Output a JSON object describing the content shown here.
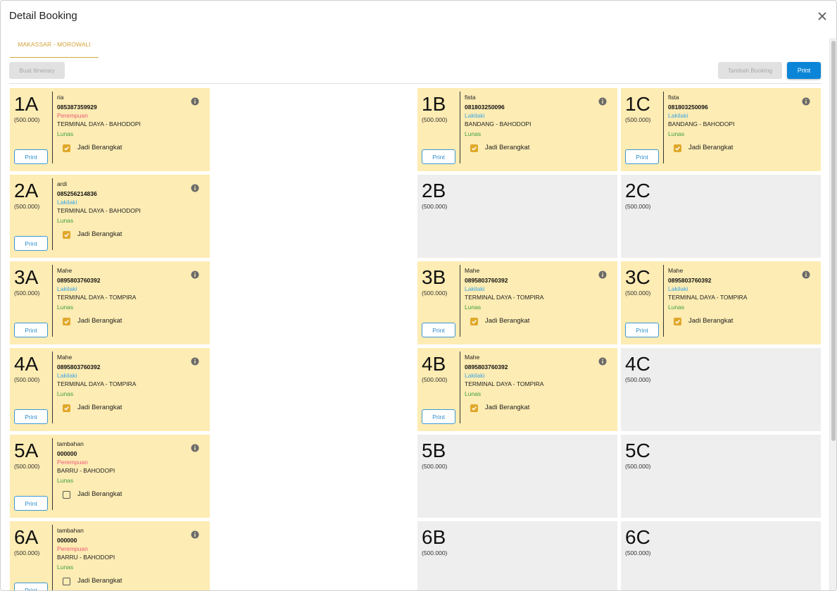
{
  "dialog": {
    "title": "Detail Booking",
    "tab_label": "MAKASSAR - MOROWALI",
    "itinerary_label": "Buat Itinerary",
    "tambah_label": "Tambah Booking",
    "print_label": "Print",
    "checkbox_label": "Jadi Berangkat",
    "seat_print_label": "Print"
  },
  "colors": {
    "accent": "#d4a33a",
    "booked_bg": "#fdecb3",
    "empty_bg": "#eeeeee",
    "primary": "#0b85d8",
    "male": "#39a7e6",
    "female": "#ee5a7a",
    "paid": "#3fa13f"
  },
  "seats": [
    {
      "code": "1A",
      "price": "(500.000)",
      "booked": true,
      "name": "ria",
      "phone": "085387359929",
      "gender": "Perempuan",
      "route": "TERMINAL DAYA - BAHODOPI",
      "status": "Lunas",
      "departed": true
    },
    {
      "code": "1B",
      "price": "(500.000)",
      "booked": true,
      "name": "fista",
      "phone": "081803250096",
      "gender": "Lakilaki",
      "route": "BANDANG - BAHODOPI",
      "status": "Lunas",
      "departed": true
    },
    {
      "code": "1C",
      "price": "(500.000)",
      "booked": true,
      "name": "fista",
      "phone": "081803250096",
      "gender": "Lakilaki",
      "route": "BANDANG - BAHODOPI",
      "status": "Lunas",
      "departed": true
    },
    {
      "code": "2A",
      "price": "(500.000)",
      "booked": true,
      "name": "ardi",
      "phone": "085256214836",
      "gender": "Lakilaki",
      "route": "TERMINAL DAYA - BAHODOPI",
      "status": "Lunas",
      "departed": true
    },
    {
      "code": "2B",
      "price": "(500.000)",
      "booked": false
    },
    {
      "code": "2C",
      "price": "(500.000)",
      "booked": false
    },
    {
      "code": "3A",
      "price": "(500.000)",
      "booked": true,
      "name": "Mahe",
      "phone": "0895803760392",
      "gender": "Lakilaki",
      "route": "TERMINAL DAYA - TOMPIRA",
      "status": "Lunas",
      "departed": true
    },
    {
      "code": "3B",
      "price": "(500.000)",
      "booked": true,
      "name": "Mahe",
      "phone": "0895803760392",
      "gender": "Lakilaki",
      "route": "TERMINAL DAYA - TOMPIRA",
      "status": "Lunas",
      "departed": true
    },
    {
      "code": "3C",
      "price": "(500.000)",
      "booked": true,
      "name": "Mahe",
      "phone": "0895803760392",
      "gender": "Lakilaki",
      "route": "TERMINAL DAYA - TOMPIRA",
      "status": "Lunas",
      "departed": true
    },
    {
      "code": "4A",
      "price": "(500.000)",
      "booked": true,
      "name": "Mahe",
      "phone": "0895803760392",
      "gender": "Lakilaki",
      "route": "TERMINAL DAYA - TOMPIRA",
      "status": "Lunas",
      "departed": true
    },
    {
      "code": "4B",
      "price": "(500.000)",
      "booked": true,
      "name": "Mahe",
      "phone": "0895803760392",
      "gender": "Lakilaki",
      "route": "TERMINAL DAYA - TOMPIRA",
      "status": "Lunas",
      "departed": true
    },
    {
      "code": "4C",
      "price": "(500.000)",
      "booked": false
    },
    {
      "code": "5A",
      "price": "(500.000)",
      "booked": true,
      "name": "tambahan",
      "phone": "000000",
      "gender": "Perempuan",
      "route": "BARRU - BAHODOPI",
      "status": "Lunas",
      "departed": false
    },
    {
      "code": "5B",
      "price": "(500.000)",
      "booked": false
    },
    {
      "code": "5C",
      "price": "(500.000)",
      "booked": false
    },
    {
      "code": "6A",
      "price": "(500.000)",
      "booked": true,
      "name": "tambahan",
      "phone": "000000",
      "gender": "Perempuan",
      "route": "BARRU - BAHODOPI",
      "status": "Lunas",
      "departed": false
    },
    {
      "code": "6B",
      "price": "(500.000)",
      "booked": false
    },
    {
      "code": "6C",
      "price": "(500.000)",
      "booked": false
    }
  ]
}
